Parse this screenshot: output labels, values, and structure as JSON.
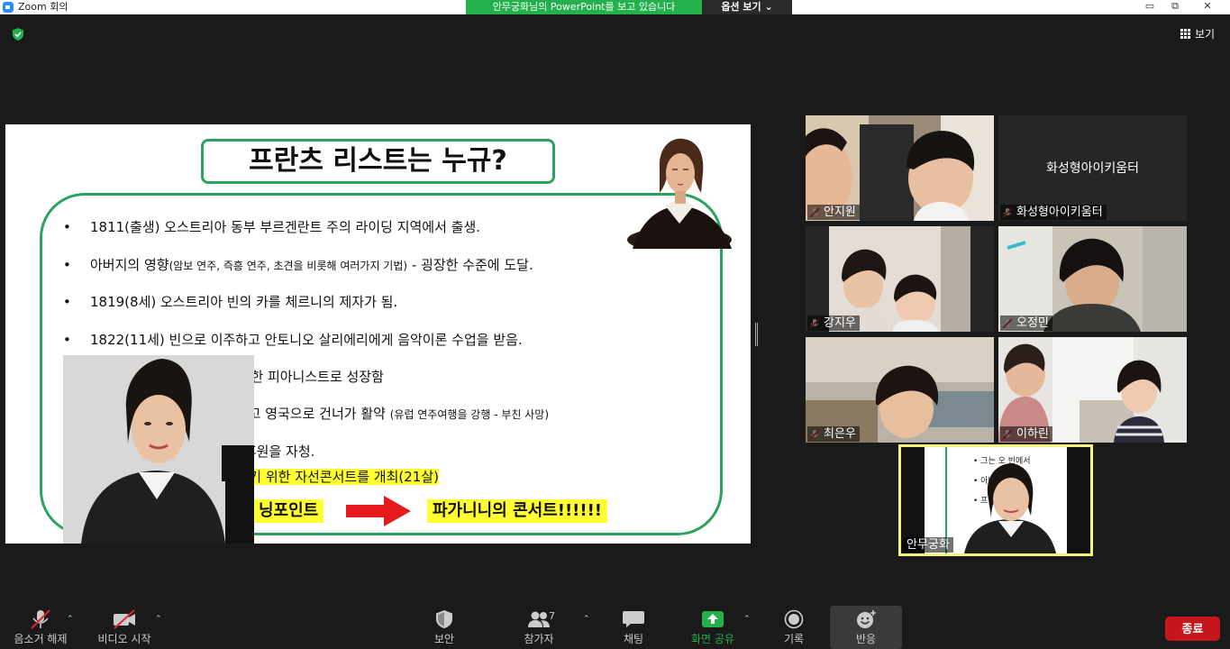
{
  "window": {
    "title": "Zoom 회의",
    "share_banner": "안무궁화님의 PowerPoint를 보고 있습니다",
    "view_options": "옵션 보기 ⌄",
    "min": "▭",
    "restore": "⧉",
    "close": "✕"
  },
  "top_right": {
    "view_label": "보기"
  },
  "slide": {
    "title": "프란츠 리스트는 누규?",
    "bullets": [
      {
        "text": "1811(출생) 오스트리아 동부 부르겐란트 주의 라이딩 지역에서 출생."
      },
      {
        "text_a": "아버지의 영향",
        "text_small": "(암보 연주, 즉흥 연주, 초견을 비롯해 여러가지 기법)",
        "text_b": " - 굉장한 수준에 도달."
      },
      {
        "text": "1819(8세) 오스트리아 빈의 카를 체르니의 제자가 됨."
      },
      {
        "text": "1822(11세) 빈으로 이주하고 안토니오 살리에리에게 음악이론 수업을 받음."
      },
      {
        "text": "그는 오      빈°빈에서 점점 유명한 피아니스트로 성장함"
      },
      {
        "text_a": "아버지       로 파리 실력을 더 쌓고 영국으로 건너가 활약 ",
        "text_small": "(유럽 연주여행을 강행  - 부친 사망)"
      },
      {
        "text": "프랑            어려운 환경 속에서도 후원을 자청."
      },
      {
        "text": "            창궐 - 파가니니가 이들을 돕기 위한 자선콘서트를 개최(21살)"
      }
    ],
    "turning_point": "닝포인트",
    "concert": "파가니니의 콘서트!!!!!!"
  },
  "participants": [
    {
      "name": "안지원",
      "muted": true
    },
    {
      "name": "화성형아이키움터",
      "muted": true,
      "video_off": true
    },
    {
      "name": "강지우",
      "muted": true
    },
    {
      "name": "오정민",
      "muted": true
    },
    {
      "name": "최은우",
      "muted": true
    },
    {
      "name": "이하린",
      "muted": true
    }
  ],
  "self_view": {
    "name": "안무궁화"
  },
  "toolbar": {
    "unmute": "음소거 해제",
    "start_video": "비디오 시작",
    "security": "보안",
    "participants": "참가자",
    "participant_count": "7",
    "chat": "채팅",
    "share_screen": "화면 공유",
    "record": "기록",
    "reactions": "반응",
    "end": "종료"
  },
  "colors": {
    "share_green": "#22b14c",
    "slide_green": "#2ca25f",
    "highlight_yellow": "#ffff33",
    "end_red": "#c4161c",
    "self_border": "#f5f57a"
  }
}
